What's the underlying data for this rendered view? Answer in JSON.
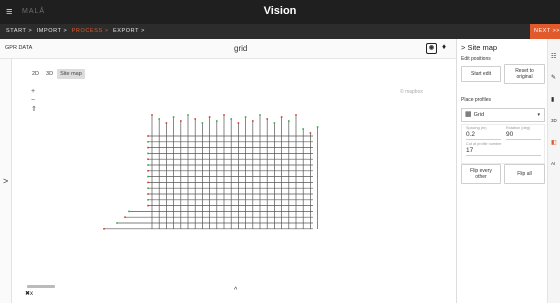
{
  "topbar": {
    "menu_icon": "hamburger-icon",
    "brand": "MALÅ",
    "title": "Vision"
  },
  "breadcrumbs": {
    "items": [
      {
        "label": "START >"
      },
      {
        "label": "IMPORT >"
      },
      {
        "label": "PROCESS >"
      },
      {
        "label": "EXPORT >"
      }
    ],
    "active_color": "#e05a2b",
    "next_label": "NEXT >>"
  },
  "gpr": {
    "title": "GPR DATA",
    "view_title": "grid",
    "fit_icon": "fit-view-icon",
    "pin_icon": "pin-icon"
  },
  "map": {
    "tabs": [
      "2D",
      "3D",
      "Site map"
    ],
    "selected_tab": "Site map",
    "zoom_in": "+",
    "zoom_out": "−",
    "compass": "⇑",
    "attribution": "© mapbox",
    "x_label": "x",
    "expand_caret": "^",
    "left_chevron": ">",
    "grid_colors": {
      "lines": "#555555",
      "start": "#d83a3a",
      "end": "#3cae4a"
    }
  },
  "sitemap_panel": {
    "header": "> Site map",
    "edit_positions_label": "Edit positions",
    "start_edit": "Start edit",
    "reset_to_original": "Reset to original",
    "place_profiles_label": "Place profiles",
    "profile_type": "Grid",
    "spacing_label": "Spacing (m)",
    "spacing_value": "0.2",
    "rotation_label": "Rotation (deg)",
    "rotation_value": "90",
    "cut_label": "Cut at profile number",
    "cut_value": "17",
    "flip_every_other": "Flip every other",
    "flip_all": "Flip all"
  },
  "right_icons": [
    {
      "icon": "list-icon",
      "glyph": "☷"
    },
    {
      "icon": "pushpin-icon",
      "glyph": "✎"
    },
    {
      "icon": "layers-icon",
      "glyph": "▮"
    },
    {
      "icon": "3d-view-icon",
      "glyph": "3D"
    },
    {
      "icon": "box-icon",
      "glyph": "◧"
    },
    {
      "icon": "ai-icon",
      "glyph": "AI"
    }
  ]
}
